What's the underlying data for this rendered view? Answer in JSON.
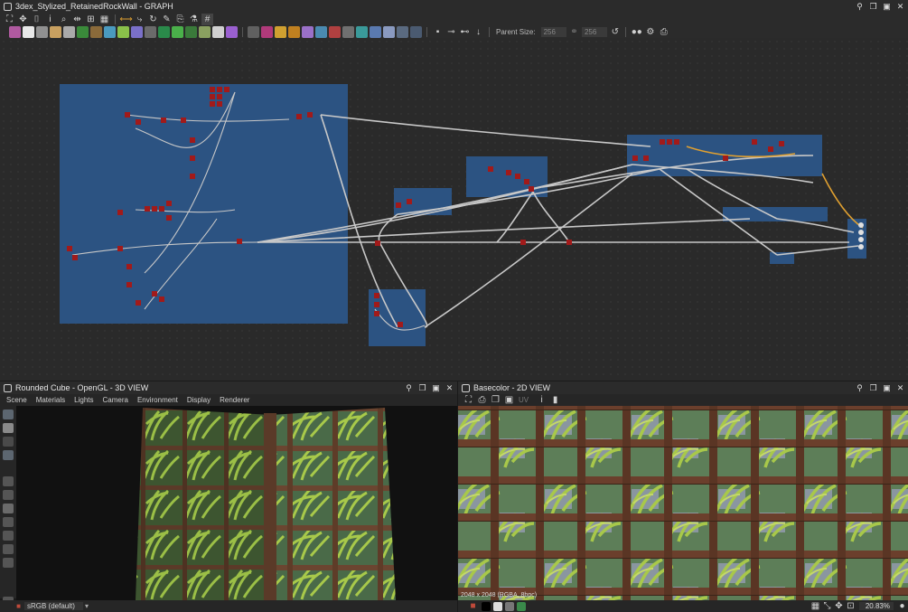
{
  "graph": {
    "title": "3dex_Stylized_RetainedRockWall - GRAPH",
    "parent_size_label": "Parent Size:",
    "parent_size_w": "256",
    "parent_size_h": "256"
  },
  "view3d": {
    "title": "Rounded Cube - OpenGL - 3D VIEW",
    "menu": [
      "Scene",
      "Materials",
      "Lights",
      "Camera",
      "Environment",
      "Display",
      "Renderer"
    ],
    "colorspace": "sRGB (default)"
  },
  "view2d": {
    "title": "Basecolor - 2D VIEW",
    "status": "2048 x 2048 (RGBA, 8bpc)",
    "zoom": "20.83%",
    "channel": "UV"
  },
  "colors": {
    "frame": "#2c5585",
    "background": "#2a2a2a",
    "panel": "#2b2b2b",
    "wire": "#c8c8c8",
    "wire_orange": "#e0a030",
    "node_red": "#a11a1a"
  }
}
